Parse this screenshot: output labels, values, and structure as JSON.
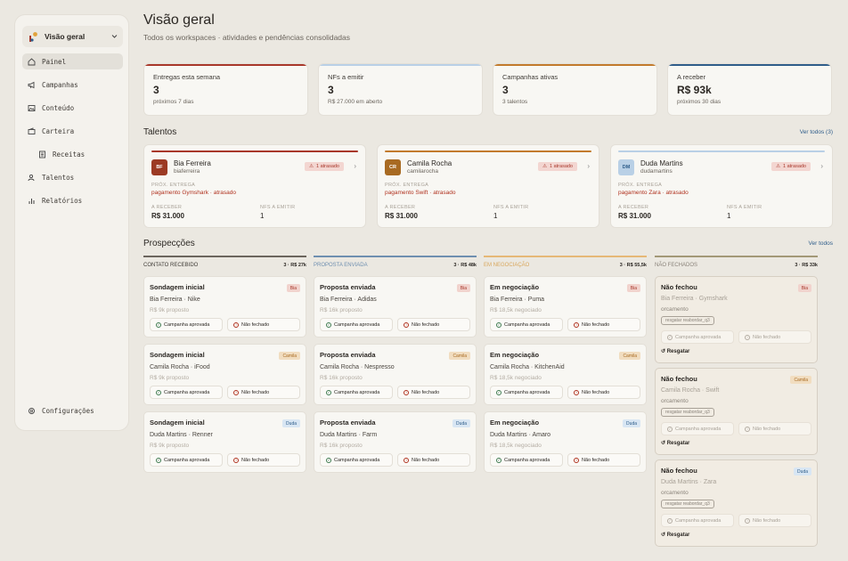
{
  "sidebar": {
    "workspace": "Visão geral",
    "items": [
      {
        "label": "Painel",
        "icon": "home-icon"
      },
      {
        "label": "Campanhas",
        "icon": "megaphone-icon"
      },
      {
        "label": "Conteúdo",
        "icon": "image-icon"
      },
      {
        "label": "Carteira",
        "icon": "wallet-icon"
      },
      {
        "label": "Receitas",
        "icon": "receipt-icon"
      },
      {
        "label": "Talentos",
        "icon": "users-icon"
      },
      {
        "label": "Relatórios",
        "icon": "bar-chart-icon"
      }
    ],
    "settings": "Configurações"
  },
  "header": {
    "title": "Visão geral",
    "subtitle": "Todos os workspaces · atividades e pendências consolidadas"
  },
  "stats": [
    {
      "label": "Entregas esta semana",
      "value": "3",
      "sub": "próximos 7 dias",
      "color": "#a8372a"
    },
    {
      "label": "NFs a emitir",
      "value": "3",
      "sub": "R$ 27.000 em aberto",
      "color": "#b9d0e6"
    },
    {
      "label": "Campanhas ativas",
      "value": "3",
      "sub": "3 talentos",
      "color": "#c27a2c"
    },
    {
      "label": "A receber",
      "value": "R$ 93k",
      "sub": "próximos 30 dias",
      "color": "#2f5d8a"
    }
  ],
  "talents_section": {
    "title": "Talentos",
    "link": "Ver todos (3)"
  },
  "talents": [
    {
      "initials": "BF",
      "name": "Bia Ferreira",
      "handle": "biaferreira",
      "badge": "1 atrasado",
      "next_label": "PRÓX. ENTREGA",
      "next": "pagamento Gymshark · atrasado",
      "recv_label": "A RECEBER",
      "recv": "R$ 31.000",
      "nf_label": "NFS A EMITIR",
      "nf": "1",
      "color": "#a8372a",
      "avatar": "#9c3a24"
    },
    {
      "initials": "CR",
      "name": "Camila Rocha",
      "handle": "camilarocha",
      "badge": "1 atrasado",
      "next_label": "PRÓX. ENTREGA",
      "next": "pagamento Swift · atrasado",
      "recv_label": "A RECEBER",
      "recv": "R$ 31.000",
      "nf_label": "NFS A EMITIR",
      "nf": "1",
      "color": "#c27a2c",
      "avatar": "#a86a22"
    },
    {
      "initials": "DM",
      "name": "Duda Martins",
      "handle": "dudamartins",
      "badge": "1 atrasado",
      "next_label": "PRÓX. ENTREGA",
      "next": "pagamento Zara · atrasado",
      "recv_label": "A RECEBER",
      "recv": "R$ 31.000",
      "nf_label": "NFS A EMITIR",
      "nf": "1",
      "color": "#b9d0e6",
      "avatar": "#b9d0e6"
    }
  ],
  "pipeline_section": {
    "title": "Prospecções",
    "link": "Ver todos"
  },
  "columns": [
    {
      "name": "CONTATO RECEBIDO",
      "count": "3 · R$ 27k",
      "color": "#6b655d"
    },
    {
      "name": "PROPOSTA ENVIADA",
      "count": "3 · R$ 48k",
      "color": "#6f8fb0"
    },
    {
      "name": "EM NEGOCIAÇÃO",
      "count": "3 · R$ 55,5k",
      "color": "#e6b877"
    },
    {
      "name": "NÃO FECHADOS",
      "count": "3 · R$ 33k",
      "color": "#a39877"
    }
  ],
  "cards": [
    [
      {
        "title": "Sondagem inicial",
        "tag": "Bia",
        "line": "Bia Ferreira · Nike",
        "value": "R$ 9k proposto"
      },
      {
        "title": "Sondagem inicial",
        "tag": "Camila",
        "line": "Camila Rocha · iFood",
        "value": "R$ 9k proposto"
      },
      {
        "title": "Sondagem inicial",
        "tag": "Duda",
        "line": "Duda Martins · Renner",
        "value": "R$ 9k proposto"
      }
    ],
    [
      {
        "title": "Proposta enviada",
        "tag": "Bia",
        "line": "Bia Ferreira · Adidas",
        "value": "R$ 16k proposto"
      },
      {
        "title": "Proposta enviada",
        "tag": "Camila",
        "line": "Camila Rocha · Nespresso",
        "value": "R$ 16k proposto"
      },
      {
        "title": "Proposta enviada",
        "tag": "Duda",
        "line": "Duda Martins · Farm",
        "value": "R$ 16k proposto"
      }
    ],
    [
      {
        "title": "Em negociação",
        "tag": "Bia",
        "line": "Bia Ferreira · Puma",
        "value": "R$ 18,5k negociado"
      },
      {
        "title": "Em negociação",
        "tag": "Camila",
        "line": "Camila Rocha · KitchenAid",
        "value": "R$ 18,5k negociado"
      },
      {
        "title": "Em negociação",
        "tag": "Duda",
        "line": "Duda Martins · Amaro",
        "value": "R$ 18,5k negociado"
      }
    ]
  ],
  "lost": [
    {
      "title": "Não fechou",
      "tag": "Bia",
      "line": "Bia Ferreira · Gymshark",
      "reason": "orcamento",
      "chip": "resgatar reabordar_q3"
    },
    {
      "title": "Não fechou",
      "tag": "Camila",
      "line": "Camila Rocha · Swift",
      "reason": "orcamento",
      "chip": "resgatar reabordar_q3"
    },
    {
      "title": "Não fechou",
      "tag": "Duda",
      "line": "Duda Martins · Zara",
      "reason": "orcamento",
      "chip": "resgatar reabordar_q3"
    }
  ],
  "actions": {
    "approve": "Campanha aprovada",
    "reject": "Não fechado",
    "rescue": "Resgatar"
  }
}
